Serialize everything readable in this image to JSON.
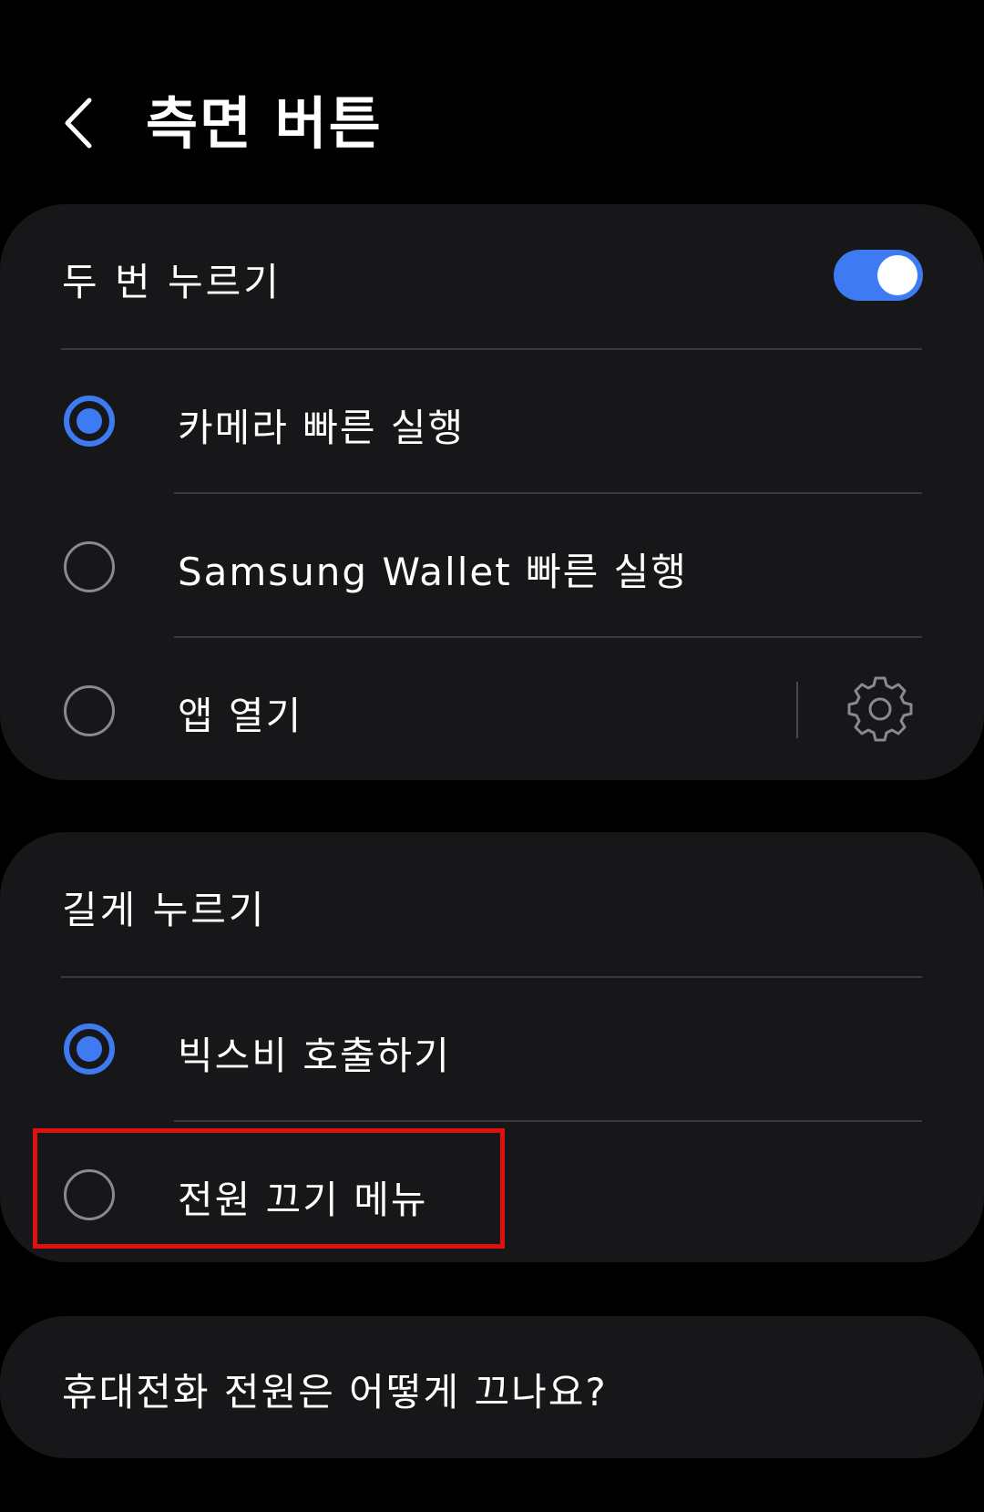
{
  "header": {
    "back_icon": "chevron-left-icon",
    "title": "측면 버튼"
  },
  "double_press": {
    "title": "두 번 누르기",
    "toggle_on": true,
    "accent_color": "#3e7bf3",
    "options": [
      {
        "label": "카메라 빠른 실행",
        "selected": true
      },
      {
        "label": "Samsung Wallet 빠른 실행",
        "selected": false
      },
      {
        "label": "앱 열기",
        "selected": false,
        "settings_icon": "gear-icon"
      }
    ]
  },
  "long_press": {
    "title": "길게 누르기",
    "options": [
      {
        "label": "빅스비 호출하기",
        "selected": true
      },
      {
        "label": "전원 끄기 메뉴",
        "selected": false
      }
    ]
  },
  "faq": {
    "label": "휴대전화 전원은 어떻게 끄나요?"
  },
  "highlight_color": "#e01010"
}
